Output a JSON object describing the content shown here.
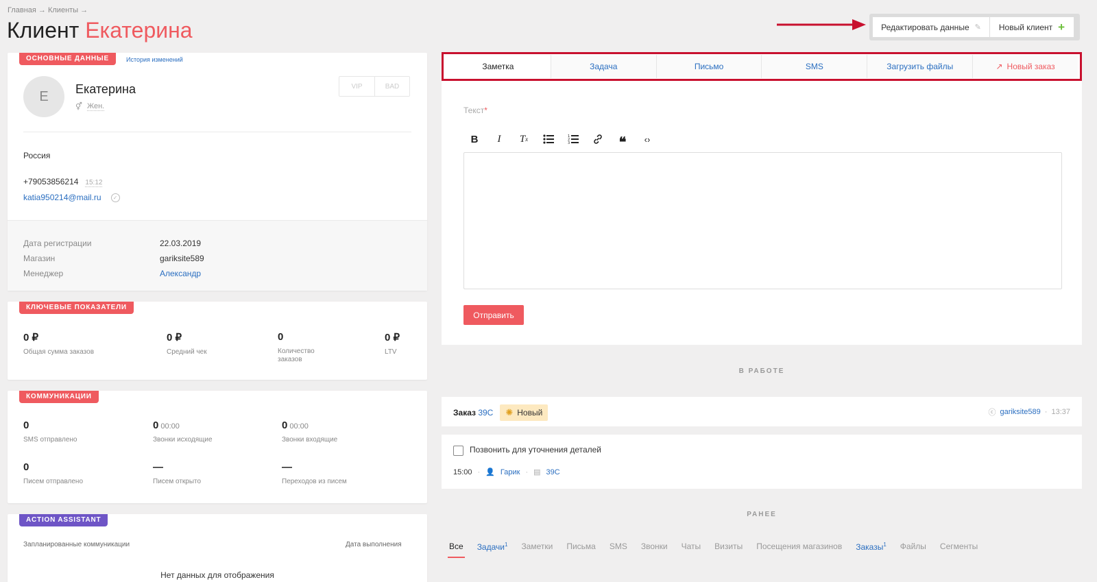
{
  "breadcrumb": "Главная → Клиенты →",
  "title": {
    "prefix": "Клиент",
    "name": "Екатерина"
  },
  "top_buttons": {
    "edit": "Редактировать данные",
    "new_client": "Новый клиент"
  },
  "main_card": {
    "badge": "Основные данные",
    "history_link": "История изменений",
    "avatar_letter": "Е",
    "name": "Екатерина",
    "gender": "Жен.",
    "vip": "VIP",
    "bad": "BAD",
    "country": "Россия",
    "phone": "+79053856214",
    "phone_time": "15:12",
    "email": "katia950214@mail.ru",
    "meta": [
      {
        "key": "Дата регистрации",
        "value": "22.03.2019"
      },
      {
        "key": "Магазин",
        "value": "gariksite589"
      },
      {
        "key": "Менеджер",
        "value": "Александр"
      }
    ]
  },
  "kpi_card": {
    "badge": "Ключевые показатели",
    "stats": [
      {
        "value": "0 ₽",
        "label": "Общая сумма заказов"
      },
      {
        "value": "0 ₽",
        "label": "Средний чек"
      },
      {
        "value": "0",
        "label": "Количество заказов"
      },
      {
        "value": "0 ₽",
        "label": "LTV"
      }
    ]
  },
  "comm_card": {
    "badge": "Коммуникации",
    "stats": [
      {
        "value": "0",
        "sub": "",
        "label": "SMS отправлено"
      },
      {
        "value": "0",
        "sub": "00:00",
        "label": "Звонки исходящие"
      },
      {
        "value": "0",
        "sub": "00:00",
        "label": "Звонки входящие"
      },
      {
        "value": "0",
        "sub": "",
        "label": "Писем отправлено"
      },
      {
        "value": "—",
        "sub": "",
        "label": "Писем открыто"
      },
      {
        "value": "—",
        "sub": "",
        "label": "Переходов из писем"
      }
    ]
  },
  "assistant_card": {
    "badge": "Action Assistant",
    "col1": "Запланированные коммуникации",
    "col2": "Дата выполнения",
    "empty": "Нет данных для отображения"
  },
  "tabs": [
    "Заметка",
    "Задача",
    "Письмо",
    "SMS",
    "Загрузить файлы",
    "Новый заказ"
  ],
  "editor": {
    "label": "Текст",
    "required": "*",
    "send": "Отправить",
    "toolbar": [
      "bold-icon",
      "italic-icon",
      "clear-format-icon",
      "bullet-list-icon",
      "numbered-list-icon",
      "link-icon",
      "quote-icon",
      "code-icon"
    ]
  },
  "in_work": "В работе",
  "order": {
    "label": "Заказ",
    "number": "39C",
    "status": "Новый",
    "shop": "gariksite589",
    "time": "13:37"
  },
  "task": {
    "title": "Позвонить для уточнения деталей",
    "time": "15:00",
    "user": "Гарик",
    "order": "39C"
  },
  "earlier": "Ранее",
  "filters": [
    {
      "label": "Все",
      "sup": ""
    },
    {
      "label": "Задачи",
      "sup": "1"
    },
    {
      "label": "Заметки",
      "sup": ""
    },
    {
      "label": "Письма",
      "sup": ""
    },
    {
      "label": "SMS",
      "sup": ""
    },
    {
      "label": "Звонки",
      "sup": ""
    },
    {
      "label": "Чаты",
      "sup": ""
    },
    {
      "label": "Визиты",
      "sup": ""
    },
    {
      "label": "Посещения магазинов",
      "sup": ""
    },
    {
      "label": "Заказы",
      "sup": "1"
    },
    {
      "label": "Файлы",
      "sup": ""
    },
    {
      "label": "Сегменты",
      "sup": ""
    }
  ],
  "colors": {
    "accent": "#ef5a5f",
    "link": "#2a6ec0",
    "purple": "#6e55c6",
    "highlight": "#c8102e"
  }
}
